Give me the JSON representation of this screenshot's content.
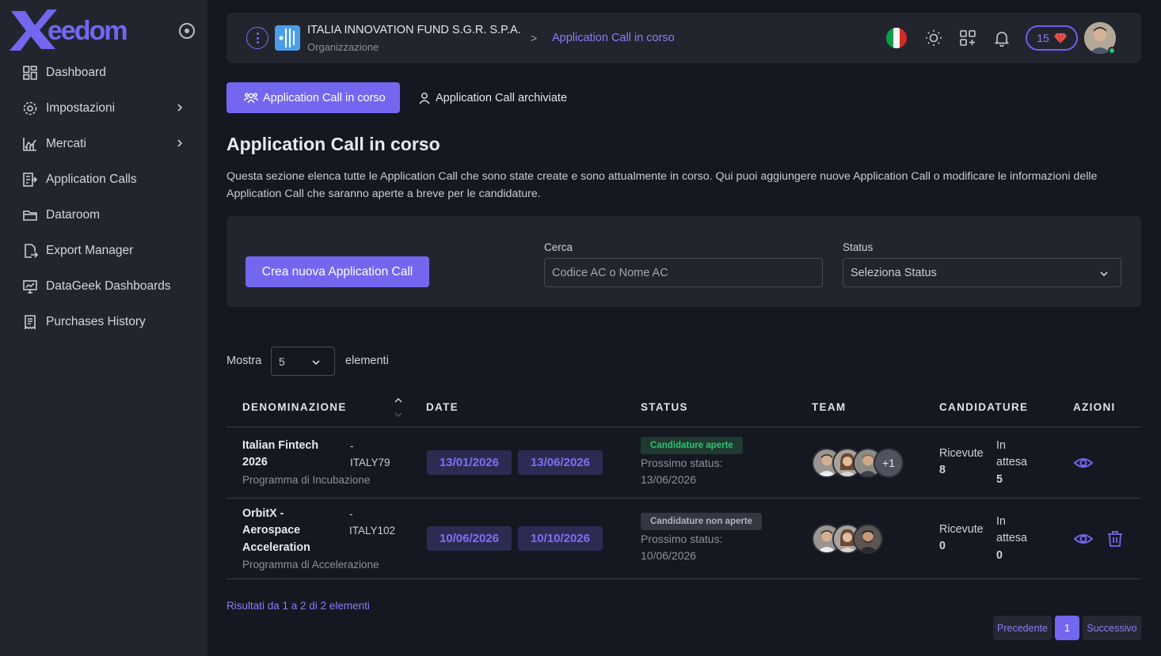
{
  "brand": {
    "name": "Xeedom",
    "accent": "#7367f0"
  },
  "sidebar": {
    "items": [
      {
        "label": "Dashboard",
        "icon": "dashboard-icon",
        "has_children": false
      },
      {
        "label": "Impostazioni",
        "icon": "settings-icon",
        "has_children": true
      },
      {
        "label": "Mercati",
        "icon": "chart-icon",
        "has_children": true
      },
      {
        "label": "Application Calls",
        "icon": "application-calls-icon",
        "has_children": false
      },
      {
        "label": "Dataroom",
        "icon": "folder-icon",
        "has_children": false
      },
      {
        "label": "Export Manager",
        "icon": "export-icon",
        "has_children": false
      },
      {
        "label": "DataGeek Dashboards",
        "icon": "monitor-icon",
        "has_children": false
      },
      {
        "label": "Purchases History",
        "icon": "receipt-icon",
        "has_children": false
      }
    ]
  },
  "header": {
    "org_name": "ITALIA INNOVATION FUND S.G.R. S.P.A.",
    "org_sub": "Organizzazione",
    "crumb_sep": ">",
    "crumb_current": "Application Call in corso",
    "credits": "15"
  },
  "tabs": [
    {
      "label": "Application Call in corso",
      "active": true
    },
    {
      "label": "Application Call archiviate",
      "active": false
    }
  ],
  "page": {
    "title": "Application Call in corso",
    "description": "Questa sezione elenca tutte le Application Call che sono state create e sono attualmente in corso. Qui puoi aggiungere nuove Application Call o modificare le informazioni delle Application Call che saranno aperte a breve per le candidature."
  },
  "filters": {
    "create_label": "Crea nuova Application Call",
    "search_label": "Cerca",
    "search_placeholder": "Codice AC o Nome AC",
    "status_label": "Status",
    "status_value": "Seleziona Status"
  },
  "length": {
    "before": "Mostra",
    "value": "5",
    "after": "elementi"
  },
  "table": {
    "columns": [
      "DENOMINAZIONE",
      "DATE",
      "STATUS",
      "TEAM",
      "CANDIDATURE",
      "AZIONI"
    ],
    "rows": [
      {
        "name_lines": [
          "Italian Fintech",
          "2026"
        ],
        "dash": "-",
        "code": "ITALY79",
        "program": "Programma di Incubazione",
        "date_start": "13/01/2026",
        "date_end": "13/06/2026",
        "status": "Candidature aperte",
        "next_label": "Prossimo status:",
        "next_date": "13/06/2026",
        "team_extra": "+1",
        "received_label": "Ricevute",
        "received": "8",
        "waiting_label_1": "In",
        "waiting_label_2": "attesa",
        "waiting": "5"
      },
      {
        "name_lines": [
          "OrbitX -",
          "Aerospace",
          "Acceleration"
        ],
        "dash": "-",
        "code": "ITALY102",
        "program": "Programma di Accelerazione",
        "date_start": "10/06/2026",
        "date_end": "10/10/2026",
        "status": "Candidature non aperte",
        "next_label": "Prossimo status:",
        "next_date": "10/06/2026",
        "received_label": "Ricevute",
        "received": "0",
        "waiting_label_1": "In",
        "waiting_label_2": "attesa",
        "waiting": "0"
      }
    ]
  },
  "footer": {
    "results": "Risultati da 1 a 2 di 2 elementi",
    "prev": "Precedente",
    "page": "1",
    "next": "Successivo"
  }
}
